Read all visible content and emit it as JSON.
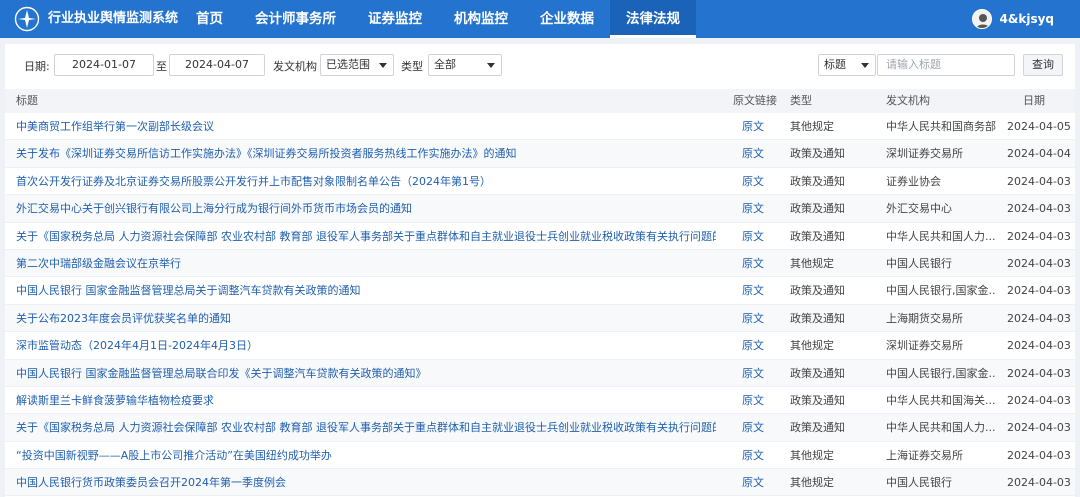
{
  "header": {
    "app_title": "行业执业舆情监测系统",
    "nav": [
      {
        "label": "首页",
        "active": false
      },
      {
        "label": "会计师事务所",
        "active": false
      },
      {
        "label": "证券监控",
        "active": false
      },
      {
        "label": "机构监控",
        "active": false
      },
      {
        "label": "企业数据",
        "active": false
      },
      {
        "label": "法律法规",
        "active": true
      }
    ],
    "user_name": "4&kjsyq"
  },
  "filters": {
    "date_label": "日期:",
    "date_from": "2024-01-07",
    "to_label": "至",
    "date_to": "2024-04-07",
    "issuer_label": "发文机构",
    "issuer_value": "已选范围",
    "type_label": "类型",
    "type_value": "全部",
    "search_field": "标题",
    "search_placeholder": "请输入标题",
    "query_button": "查询"
  },
  "table": {
    "columns": [
      "标题",
      "原文链接",
      "类型",
      "发文机构",
      "日期"
    ],
    "rows": [
      {
        "title": "中美商贸工作组举行第一次副部长级会议",
        "link": "原文",
        "type": "其他规定",
        "org": "中华人民共和国商务部",
        "date": "2024-04-05"
      },
      {
        "title": "关于发布《深圳证券交易所信访工作实施办法》《深圳证券交易所投资者服务热线工作实施办法》的通知",
        "link": "原文",
        "type": "政策及通知",
        "org": "深圳证券交易所",
        "date": "2024-04-04"
      },
      {
        "title": "首次公开发行证券及北京证券交易所股票公开发行并上市配售对象限制名单公告（2024年第1号）",
        "link": "原文",
        "type": "政策及通知",
        "org": "证券业协会",
        "date": "2024-04-03"
      },
      {
        "title": "外汇交易中心关于创兴银行有限公司上海分行成为银行间外币货币市场会员的通知",
        "link": "原文",
        "type": "政策及通知",
        "org": "外汇交易中心",
        "date": "2024-04-03"
      },
      {
        "title": "关于《国家税务总局 人力资源社会保障部 农业农村部 教育部 退役军人事务部关于重点群体和自主就业退役士兵创业就业税收政策有关执行问题的公...",
        "link": "原文",
        "type": "政策及通知",
        "org": "中华人民共和国人力...",
        "date": "2024-04-03"
      },
      {
        "title": "第二次中瑞部级金融会议在京举行",
        "link": "原文",
        "type": "其他规定",
        "org": "中国人民银行",
        "date": "2024-04-03"
      },
      {
        "title": "中国人民银行 国家金融监督管理总局关于调整汽车贷款有关政策的通知",
        "link": "原文",
        "type": "政策及通知",
        "org": "中国人民银行,国家金...",
        "date": "2024-04-03"
      },
      {
        "title": "关于公布2023年度会员评优获奖名单的通知",
        "link": "原文",
        "type": "政策及通知",
        "org": "上海期货交易所",
        "date": "2024-04-03"
      },
      {
        "title": "深市监管动态（2024年4月1日-2024年4月3日）",
        "link": "原文",
        "type": "其他规定",
        "org": "深圳证券交易所",
        "date": "2024-04-03"
      },
      {
        "title": "中国人民银行 国家金融监督管理总局联合印发《关于调整汽车贷款有关政策的通知》",
        "link": "原文",
        "type": "政策及通知",
        "org": "中国人民银行,国家金...",
        "date": "2024-04-03"
      },
      {
        "title": "解读斯里兰卡鲜食菠萝输华植物检疫要求",
        "link": "原文",
        "type": "政策及通知",
        "org": "中华人民共和国海关...",
        "date": "2024-04-03"
      },
      {
        "title": "关于《国家税务总局 人力资源社会保障部 农业农村部 教育部 退役军人事务部关于重点群体和自主就业退役士兵创业就业税收政策有关执行问题的公...",
        "link": "原文",
        "type": "政策及通知",
        "org": "中华人民共和国人力...",
        "date": "2024-04-03"
      },
      {
        "title": "“投资中国新视野——A股上市公司推介活动”在美国纽约成功举办",
        "link": "原文",
        "type": "其他规定",
        "org": "上海证券交易所",
        "date": "2024-04-03"
      },
      {
        "title": "中国人民银行货币政策委员会召开2024年第一季度例会",
        "link": "原文",
        "type": "其他规定",
        "org": "中国人民银行",
        "date": "2024-04-03"
      }
    ]
  },
  "colors": {
    "nav_bg": "#2474cf",
    "link": "#1f5fae",
    "page_bg": "#eef1f6"
  }
}
